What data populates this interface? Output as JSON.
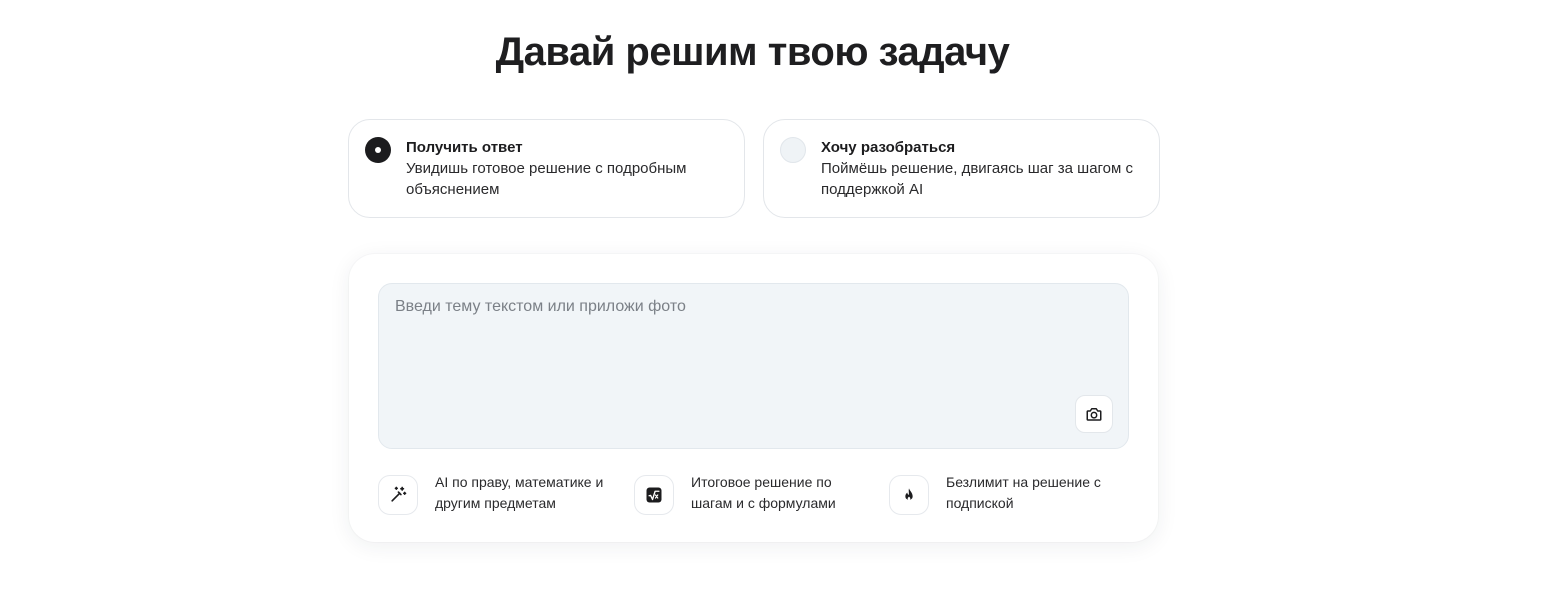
{
  "header": {
    "title": "Давай решим твою задачу"
  },
  "modes": [
    {
      "title": "Получить ответ",
      "description": "Увидишь готовое решение с подробным объяснением",
      "selected": true
    },
    {
      "title": "Хочу разобраться",
      "description": "Поймёшь решение, двигаясь шаг за шагом с поддержкой AI",
      "selected": false
    }
  ],
  "input": {
    "value": "",
    "placeholder": "Введи тему текстом или приложи фото",
    "attach_icon": "camera-icon"
  },
  "features": [
    {
      "icon": "magic-wand-icon",
      "text": "AI по праву, математике и другим предметам"
    },
    {
      "icon": "square-root-icon",
      "text": "Итоговое решение по шагам и с формулами"
    },
    {
      "icon": "flame-icon",
      "text": "Безлимит на решение с подпиской"
    }
  ],
  "colors": {
    "text": "#1c1c1e",
    "input_bg": "#f1f5f8",
    "border": "#e3e6ea",
    "radio_selected": "#1c1c1e"
  }
}
